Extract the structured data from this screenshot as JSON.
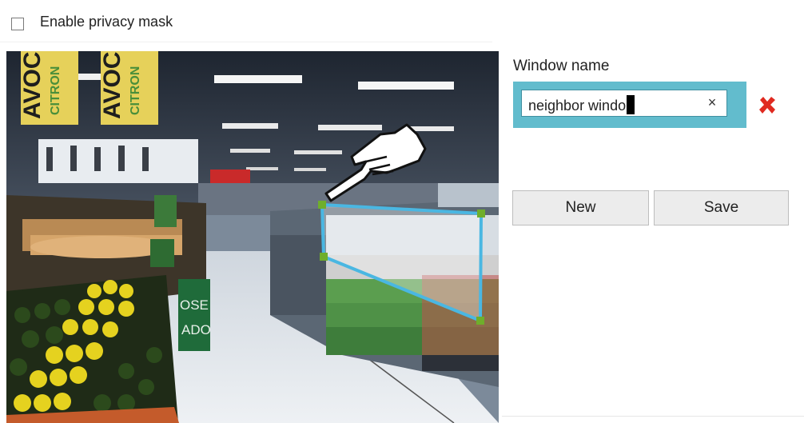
{
  "privacy_mask": {
    "checkbox_label": "Enable privacy mask",
    "checked": false
  },
  "video": {
    "sign_text_1": "AVOC",
    "sign_text_2": "CITRON",
    "sign_text_3": "AVOC",
    "sign_text_4": "CITRON",
    "sign_text_5": "OSE",
    "sign_text_6": "ADO",
    "mask_stroke_color": "#4ab7e2",
    "handle_color": "#6fae2b"
  },
  "window": {
    "label": "Window name",
    "input_value": "neighbor windo",
    "clear_label": "×",
    "accent_color": "#62bccd",
    "delete_color": "#e02a20"
  },
  "buttons": {
    "new_label": "New",
    "save_label": "Save"
  }
}
